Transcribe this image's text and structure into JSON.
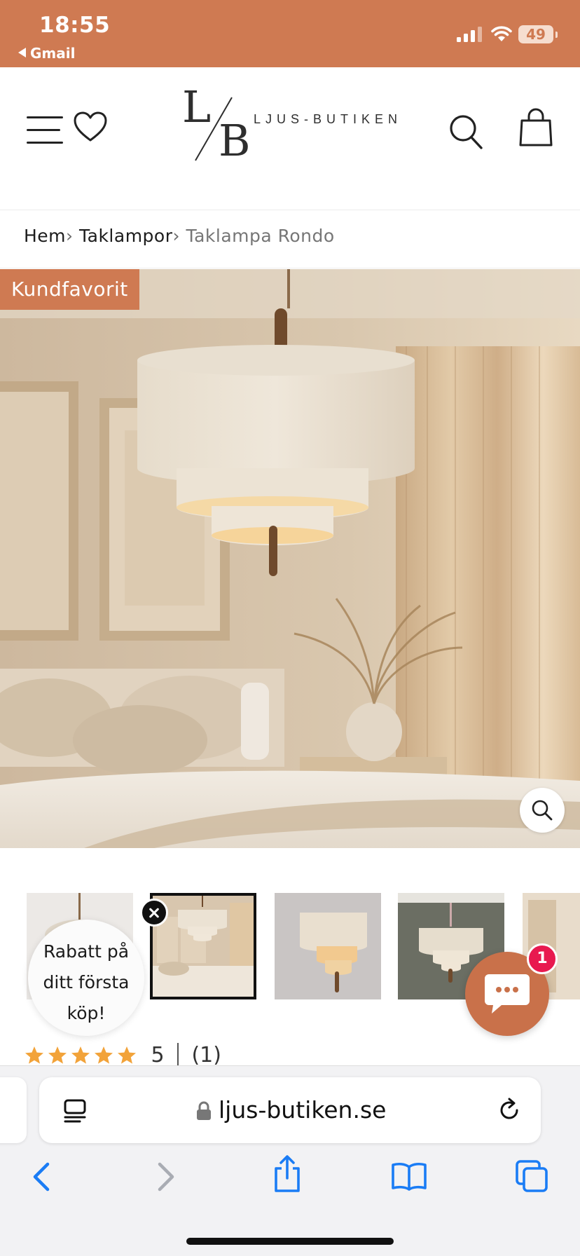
{
  "status_bar": {
    "time": "18:55",
    "back_app": "Gmail",
    "battery": "49",
    "background_color": "#cf7a52"
  },
  "header": {
    "logo_letters": "L/B",
    "logo_text": "LJUS-BUTIKEN",
    "icons": [
      "menu-icon",
      "heart-icon",
      "search-icon",
      "bag-icon"
    ]
  },
  "breadcrumb": {
    "items": [
      {
        "label": "Hem"
      },
      {
        "label": "Taklampor"
      }
    ],
    "separator": "›",
    "current": "Taklampa Rondo"
  },
  "product": {
    "badge": "Kundfavorit",
    "badge_color": "#cf7a52",
    "thumbnail_count": 5,
    "selected_thumbnail": 1,
    "rating": {
      "stars": 5,
      "score": "5",
      "count": "(1)",
      "star_color": "#f2a33a"
    }
  },
  "promo_popup": {
    "text_lines": [
      "Rabatt på",
      "ditt första",
      "köp!"
    ]
  },
  "chat": {
    "badge": "1",
    "button_color": "#c9714a",
    "badge_color": "#e8194f"
  },
  "browser": {
    "url": "ljus-butiken.se",
    "toolbar_icons": [
      "back-icon",
      "forward-icon",
      "share-icon",
      "bookmarks-icon",
      "tabs-icon"
    ],
    "accent_color": "#1a7cf5"
  }
}
